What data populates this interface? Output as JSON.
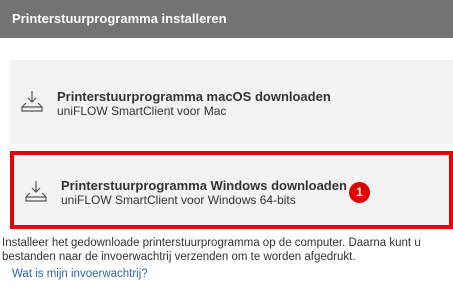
{
  "header": {
    "title": "Printerstuurprogramma installeren"
  },
  "downloads": [
    {
      "label": "Printerstuurprogramma macOS downloaden",
      "sublabel": "uniFLOW SmartClient voor Mac",
      "icon": "download-drive-icon"
    },
    {
      "label": "Printerstuurprogramma Windows downloaden",
      "sublabel": "uniFLOW SmartClient voor Windows 64-bits",
      "icon": "download-drive-icon",
      "badge": "1"
    }
  ],
  "description": "Installeer het gedownloade printerstuurprogramma op de computer. Daarna kunt u bestanden naar de invoerwachtrij verzenden om te worden afgedrukt.",
  "help_link": "Wat is mijn invoerwachtrij?",
  "colors": {
    "header_bg": "#737373",
    "card_bg": "#f3f3f3",
    "highlight": "#ea0000",
    "link": "#2f66b3"
  }
}
